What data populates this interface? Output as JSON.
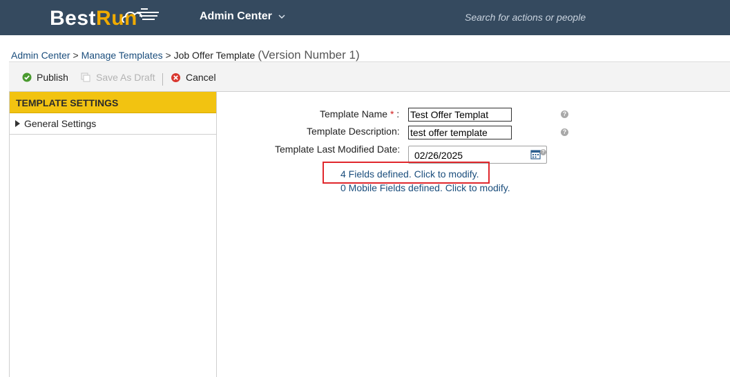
{
  "header": {
    "logo_part1": "Best",
    "logo_part2": "Run",
    "module_label": "Admin Center",
    "search_placeholder": "Search for actions or people"
  },
  "breadcrumb": {
    "items": [
      "Admin Center",
      "Manage Templates"
    ],
    "separator": ">",
    "current": "Job Offer Template",
    "version": "(Version Number 1)"
  },
  "toolbar": {
    "publish_label": "Publish",
    "save_draft_label": "Save As Draft",
    "cancel_label": "Cancel"
  },
  "sidebar": {
    "header": "TEMPLATE SETTINGS",
    "items": [
      {
        "label": "General Settings"
      }
    ]
  },
  "form": {
    "template_name_label": "Template Name",
    "required_marker": "*",
    "colon": ":",
    "template_name_value": "Test Offer Templat",
    "template_description_label": "Template Description:",
    "template_description_value": "test offer template",
    "last_modified_label": "Template Last Modified Date:",
    "last_modified_value": "02/26/2025",
    "fields_link": "4 Fields defined. Click to modify.",
    "mobile_fields_link": "0 Mobile Fields defined. Click to modify.",
    "help_glyph": "?"
  },
  "colors": {
    "shellbar": "#354a5f",
    "accent": "#f0ab00",
    "panel_header": "#f2c311",
    "link": "#1a4d7c",
    "highlight": "#e0262b"
  }
}
